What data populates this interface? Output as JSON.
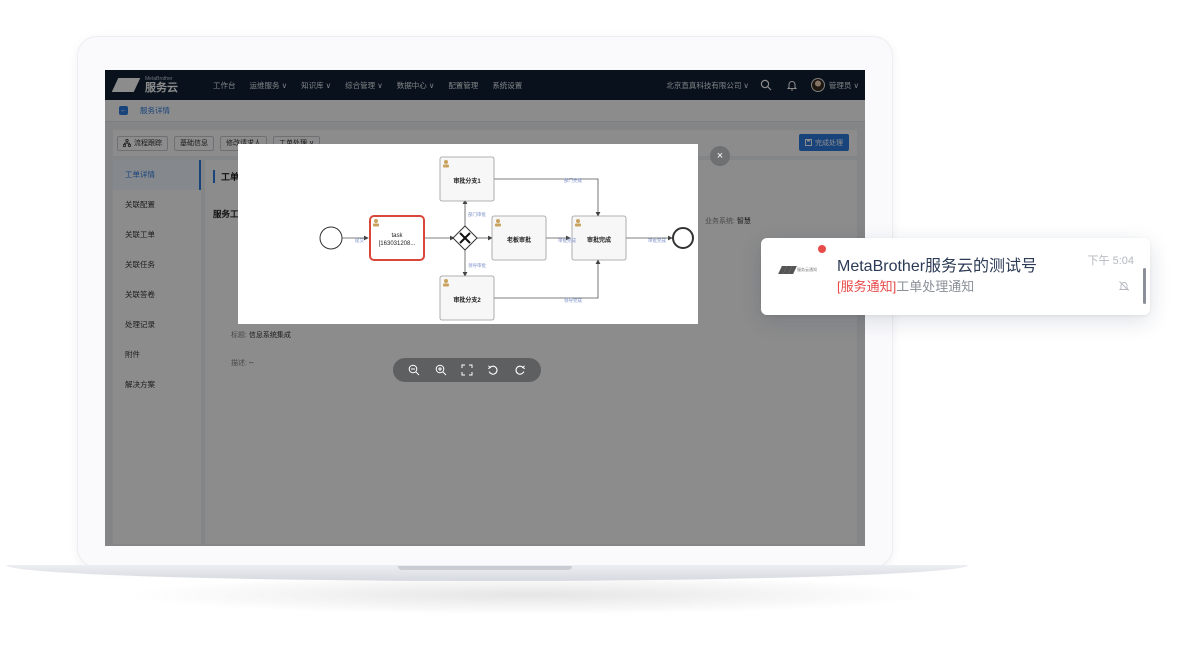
{
  "app": {
    "logo_en": "MetaBrother",
    "logo_cn": "服务云",
    "nav": [
      {
        "label": "工作台"
      },
      {
        "label": "运维服务 ∨"
      },
      {
        "label": "知识库 ∨"
      },
      {
        "label": "综合管理 ∨"
      },
      {
        "label": "数据中心 ∨"
      },
      {
        "label": "配置管理"
      },
      {
        "label": "系统设置"
      }
    ],
    "company": "北京直真科技有限公司 ∨",
    "user": "管理员 ∨",
    "icons": {
      "search": "search-icon",
      "bell": "bell-icon"
    }
  },
  "breadcrumb": {
    "title": "服务详情"
  },
  "toolbar": {
    "buttons": [
      "流程跟踪",
      "基础信息",
      "修改请求人",
      "工单处理 ∨"
    ],
    "done": "完成处理"
  },
  "sidemenu": {
    "items": [
      "工单详情",
      "关联配置",
      "关联工单",
      "关联任务",
      "关联答卷",
      "处理记录",
      "附件",
      "解决方案"
    ]
  },
  "content": {
    "section_title": "工单",
    "sub_title": "服务工",
    "biz_label": "业务系统:",
    "biz_value": "智慧",
    "title_label": "标题:",
    "title_value": "信息系统集成",
    "desc_label": "描述:",
    "desc_value": "--"
  },
  "flow": {
    "nodes": {
      "task": "task",
      "task_id": "[163031208...",
      "branch1": "审批分支1",
      "branch2": "审批分支2",
      "boss": "老板审批",
      "done": "审批完成"
    },
    "edges": {
      "e_start": "提交",
      "e_up": "部门审批",
      "e_down": "领导审批",
      "e_boss": "审批完成",
      "e_end": "审批完成",
      "e_b1": "部门完成",
      "e_b2": "领导完成"
    }
  },
  "notification": {
    "title": "MetaBrother服务云的测试号",
    "time": "下午 5:04",
    "tag": "[服务通知]",
    "message": "工单处理通知",
    "logo_text": "服务云通知"
  },
  "colors": {
    "nav_bg": "#0f1f33",
    "accent": "#2f7de1",
    "alert": "#e84a4a"
  }
}
